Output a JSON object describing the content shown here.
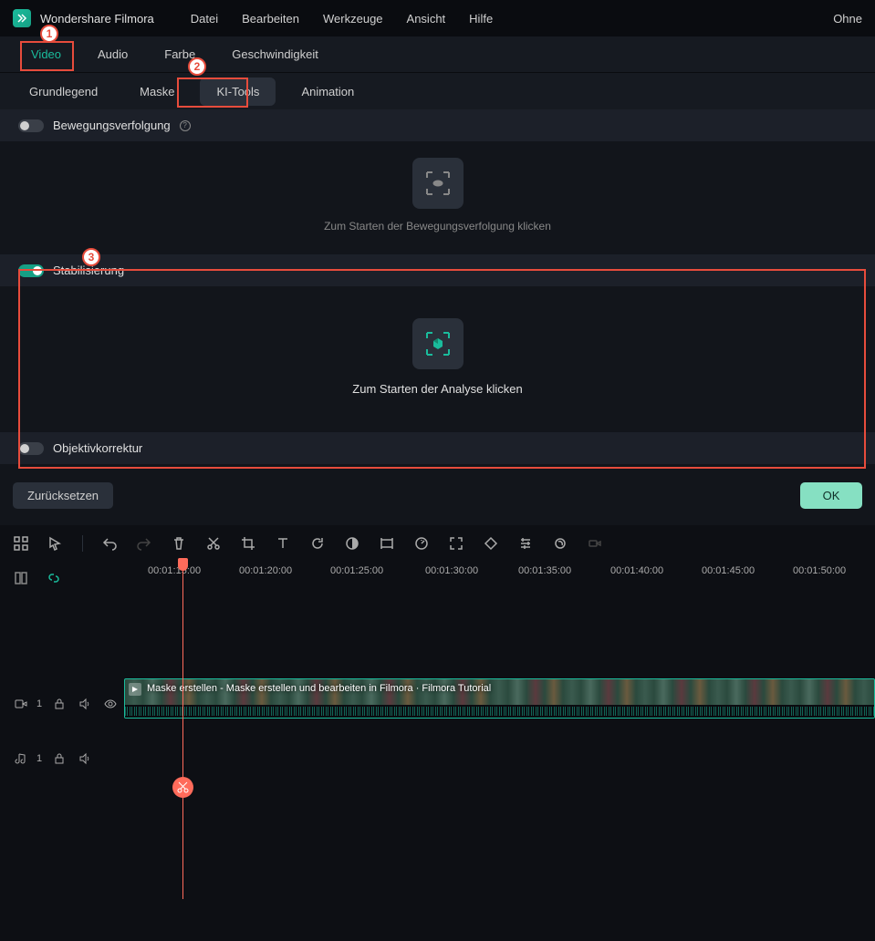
{
  "app": {
    "title": "Wondershare Filmora",
    "right_label": "Ohne"
  },
  "menu": [
    "Datei",
    "Bearbeiten",
    "Werkzeuge",
    "Ansicht",
    "Hilfe"
  ],
  "top_tabs": [
    "Video",
    "Audio",
    "Farbe",
    "Geschwindigkeit"
  ],
  "top_tab_active": 0,
  "sub_tabs": [
    "Grundlegend",
    "Maske",
    "KI-Tools",
    "Animation"
  ],
  "sub_tab_active": 2,
  "sections": {
    "motion_tracking": {
      "label": "Bewegungsverfolgung",
      "enabled": false,
      "hint": "Zum Starten der Bewegungsverfolgung klicken"
    },
    "stabilization": {
      "label": "Stabilisierung",
      "enabled": true,
      "hint": "Zum Starten der Analyse klicken"
    },
    "lens_correction": {
      "label": "Objektivkorrektur",
      "enabled": false
    }
  },
  "actions": {
    "reset": "Zurücksetzen",
    "ok": "OK"
  },
  "annotations": {
    "1": "1",
    "2": "2",
    "3": "3"
  },
  "timeline": {
    "playhead": "00:01:15:00",
    "ruler": [
      "00:01:15:00",
      "00:01:20:00",
      "00:01:25:00",
      "00:01:30:00",
      "00:01:35:00",
      "00:01:40:00",
      "00:01:45:00",
      "00:01:50:00"
    ],
    "video_track": {
      "index": "1",
      "clip_label": "Maske erstellen - Maske erstellen und bearbeiten in Filmora · Filmora Tutorial"
    },
    "audio_track": {
      "index": "1"
    }
  }
}
